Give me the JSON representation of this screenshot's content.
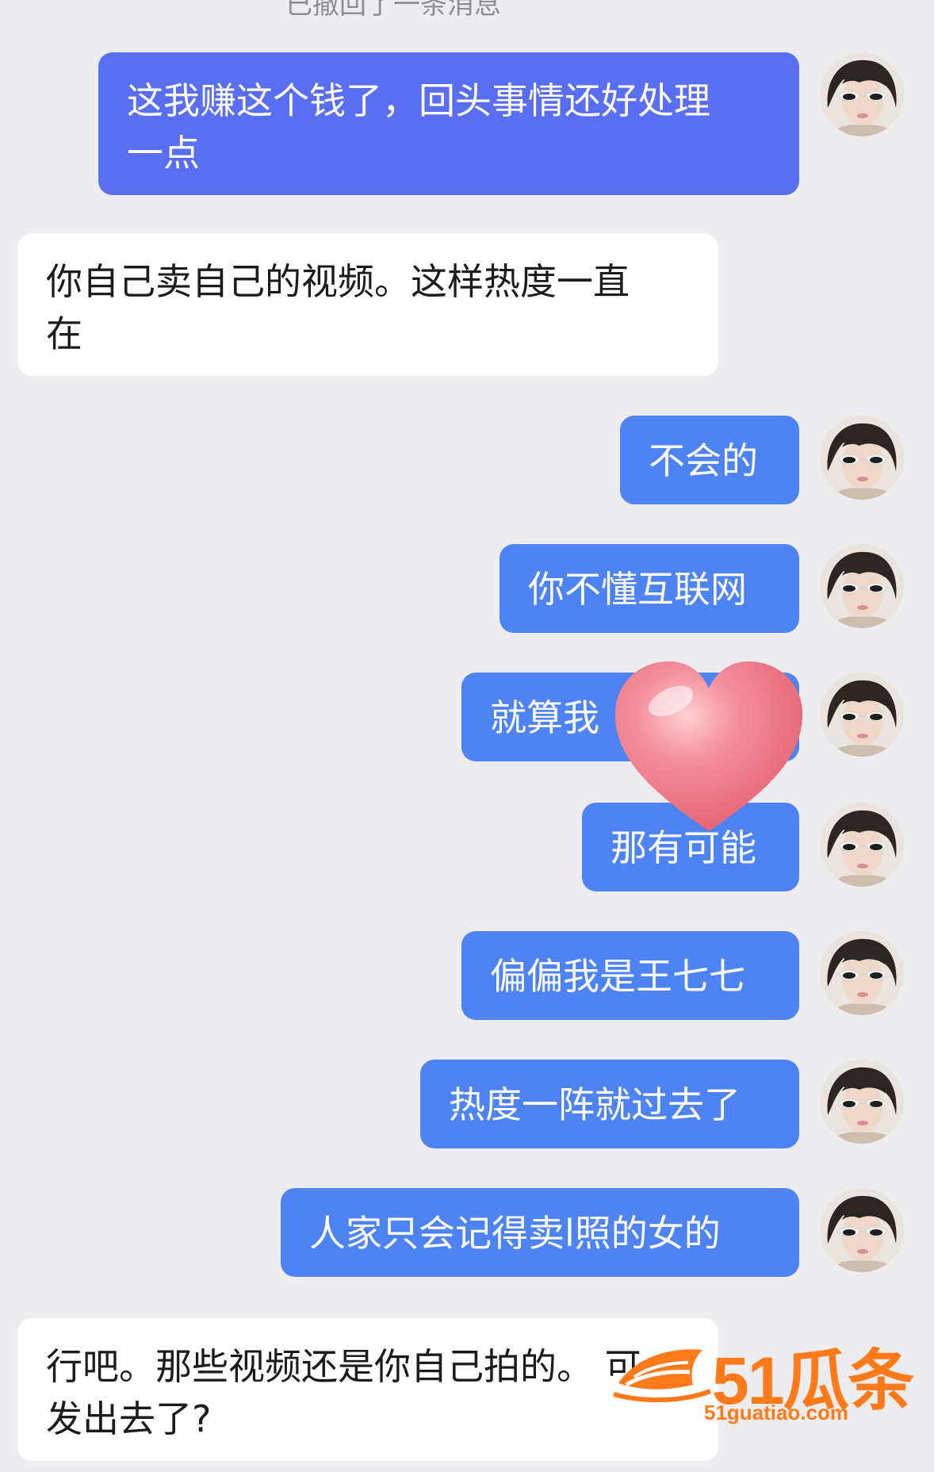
{
  "chat": {
    "top_notice": "已撤回了一条消息",
    "messages": [
      {
        "side": "out",
        "text": "这我赚这个钱了，回头事情还好处理\n一点"
      },
      {
        "side": "in",
        "text": "你自己卖自己的视频。这样热度一直\n在"
      },
      {
        "side": "out",
        "text": "不会的"
      },
      {
        "side": "out",
        "text": "你不懂互联网"
      },
      {
        "side": "out",
        "text": "就算我"
      },
      {
        "side": "out",
        "text": "那有可能"
      },
      {
        "side": "out",
        "text": "偏偏我是王七七"
      },
      {
        "side": "out",
        "text": "热度一阵就过去了"
      },
      {
        "side": "out",
        "text": "人家只会记得卖l照的女的"
      },
      {
        "side": "in",
        "text": "行吧。那些视频还是你自己拍的。 可\n发出去了?"
      }
    ]
  },
  "sticker": {
    "icon": "heart-icon",
    "color": "#f07a86"
  },
  "watermark": {
    "logo_text": "51瓜条",
    "url": "51guatiao.com",
    "icon": "fish-icon",
    "color": "#ff7a1a"
  },
  "colors": {
    "background": "#ededef",
    "outgoing_bubble": "#4e83f4",
    "incoming_bubble": "#ffffff"
  }
}
